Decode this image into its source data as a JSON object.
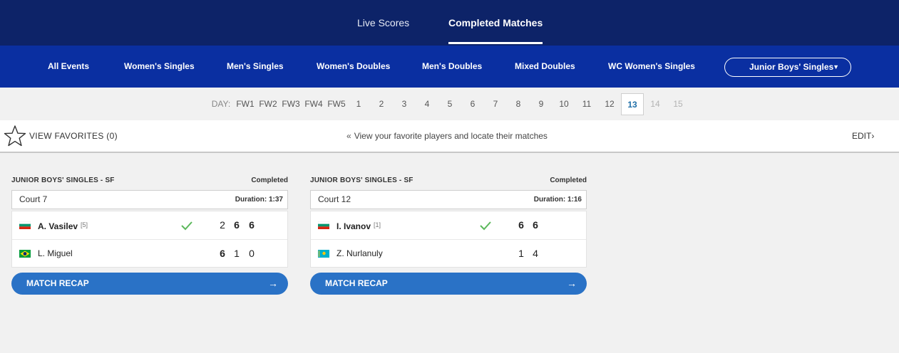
{
  "top_tabs": [
    "Live Scores",
    "Completed Matches"
  ],
  "events": [
    "All Events",
    "Women's Singles",
    "Men's Singles",
    "Women's Doubles",
    "Men's Doubles",
    "Mixed Doubles",
    "WC Women's Singles"
  ],
  "event_dropdown": {
    "selected": "Junior Boys' Singles",
    "caret": "▼"
  },
  "days": {
    "label": "DAY:",
    "items": [
      "FW1",
      "FW2",
      "FW3",
      "FW4",
      "FW5",
      "1",
      "2",
      "3",
      "4",
      "5",
      "6",
      "7",
      "8",
      "9",
      "10",
      "11",
      "12",
      "13",
      "14",
      "15"
    ],
    "selected": "13",
    "disabled": [
      "14",
      "15"
    ]
  },
  "favorites": {
    "label": "VIEW FAVORITES (0)",
    "hint_chevron": "«",
    "hint": "View your favorite players and locate their matches",
    "edit": "EDIT›"
  },
  "matches": [
    {
      "round": "JUNIOR BOYS' SINGLES - SF",
      "status": "Completed",
      "court": "Court 7",
      "duration": "Duration: 1:37",
      "recap": "MATCH RECAP",
      "arrow": "→",
      "players": [
        {
          "name": "A. Vasilev",
          "seed": "[5]",
          "flag": "bulgaria",
          "winner": true,
          "scores": [
            "2",
            "6",
            "6"
          ]
        },
        {
          "name": "L. Miguel",
          "seed": "",
          "flag": "brazil",
          "winner": false,
          "scores": [
            "6",
            "1",
            "0"
          ]
        }
      ]
    },
    {
      "round": "JUNIOR BOYS' SINGLES - SF",
      "status": "Completed",
      "court": "Court 12",
      "duration": "Duration: 1:16",
      "recap": "MATCH RECAP",
      "arrow": "→",
      "players": [
        {
          "name": "I. Ivanov",
          "seed": "[1]",
          "flag": "bulgaria",
          "winner": true,
          "scores": [
            "6",
            "6"
          ]
        },
        {
          "name": "Z. Nurlanuly",
          "seed": "",
          "flag": "kazakhstan",
          "winner": false,
          "scores": [
            "1",
            "4"
          ]
        }
      ]
    }
  ],
  "colors": {
    "top_bar": "#0d2368",
    "event_bar": "#0a2fa1",
    "button": "#2a72c6",
    "check": "#5cb85c",
    "selected_day": "#1f6fa8"
  }
}
